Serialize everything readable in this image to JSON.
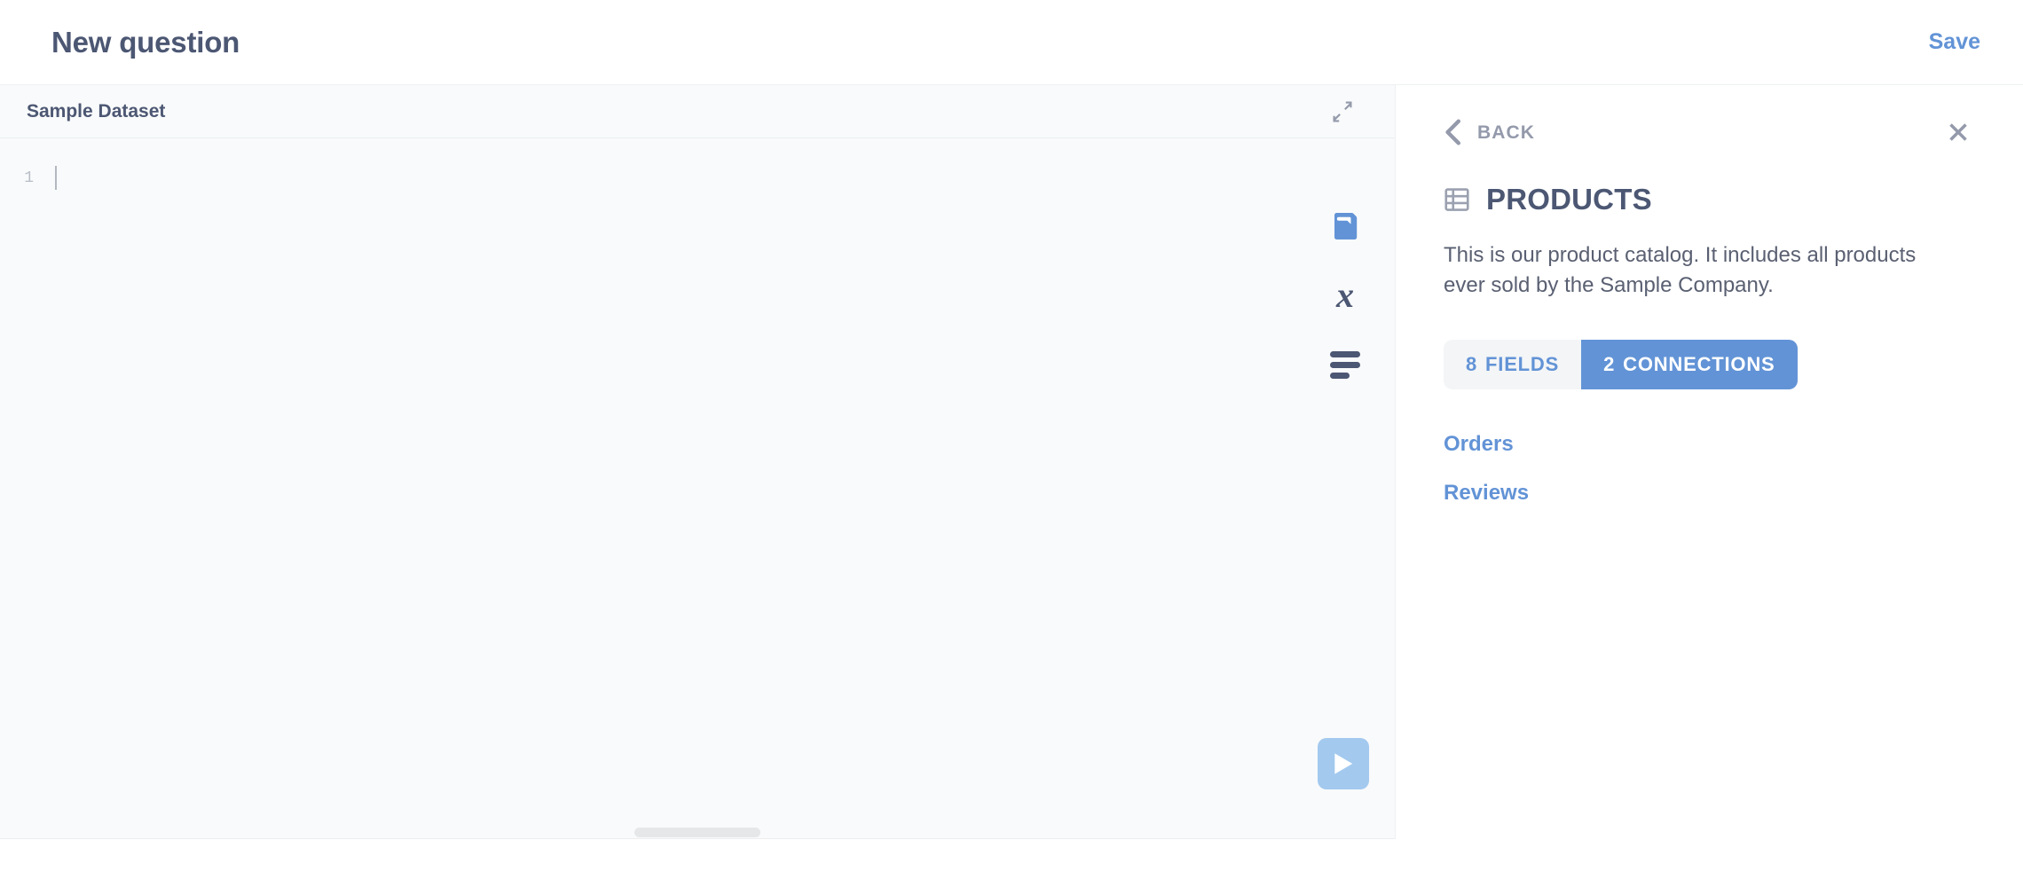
{
  "header": {
    "title": "New question",
    "save_label": "Save"
  },
  "editor": {
    "database_name": "Sample Dataset",
    "collapse_icon": "contract-arrows-icon",
    "line_numbers": [
      "1"
    ],
    "code_lines": [
      ""
    ],
    "side_actions": [
      {
        "icon": "data-reference-book-icon",
        "name": "data-reference-button",
        "active": true
      },
      {
        "icon": "variables-x-icon",
        "name": "variables-button",
        "active": false
      },
      {
        "icon": "format-query-icon",
        "name": "format-query-button",
        "active": false
      }
    ],
    "run_icon": "play-triangle-icon",
    "drag_handle": "resize-handle"
  },
  "reference_panel": {
    "back_label": "BACK",
    "back_icon": "chevron-left-icon",
    "close_icon": "close-x-icon",
    "table_icon": "table-grid-icon",
    "table_name": "PRODUCTS",
    "description": "This is our product catalog. It includes all products ever sold by the Sample Company.",
    "tabs": [
      {
        "count": "8",
        "label": "FIELDS",
        "active": false
      },
      {
        "count": "2",
        "label": "CONNECTIONS",
        "active": true
      }
    ],
    "connections": [
      {
        "label": "Orders"
      },
      {
        "label": "Reviews"
      }
    ]
  },
  "colors": {
    "brand_blue": "#6293d6",
    "text_dark": "#4c5773",
    "text_muted": "#949aab",
    "editor_bg": "#f9fafb",
    "run_button": "#a3c9ef"
  }
}
